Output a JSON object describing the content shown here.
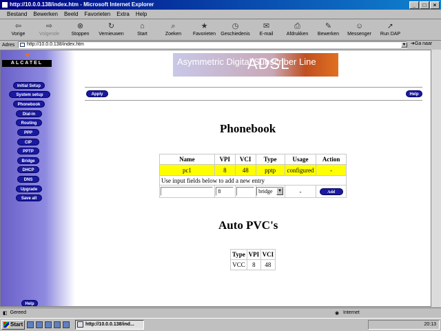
{
  "window": {
    "title": "http://10.0.0.138/index.htm - Microsoft Internet Explorer"
  },
  "menu": [
    "Bestand",
    "Bewerken",
    "Beeld",
    "Favorieten",
    "Extra",
    "Help"
  ],
  "toolbar": [
    {
      "label": "Vorige",
      "icon": "back-icon"
    },
    {
      "label": "Volgende",
      "icon": "forward-icon",
      "disabled": true
    },
    {
      "label": "Stoppen",
      "icon": "stop-icon"
    },
    {
      "label": "Vernieuwen",
      "icon": "refresh-icon"
    },
    {
      "label": "Start",
      "icon": "home-icon"
    },
    {
      "label": "Zoeken",
      "icon": "search-icon"
    },
    {
      "label": "Favorieten",
      "icon": "favorites-icon"
    },
    {
      "label": "Geschiedenis",
      "icon": "history-icon"
    },
    {
      "label": "E-mail",
      "icon": "mail-icon"
    },
    {
      "label": "Afdrukken",
      "icon": "print-icon"
    },
    {
      "label": "Bewerken",
      "icon": "edit-icon"
    },
    {
      "label": "Messenger",
      "icon": "messenger-icon"
    },
    {
      "label": "Run DAP",
      "icon": "dap-icon"
    }
  ],
  "address": {
    "label": "Adres",
    "url": "http://10.0.0.138/index.htm",
    "go": "Ga naar"
  },
  "sidebar": {
    "logo": "ALCATEL",
    "items": [
      "Initial Setup",
      "System setup",
      "Phonebook",
      "Dial-in",
      "Routing",
      "PPP",
      "CIP",
      "PPTP",
      "Bridge",
      "DHCP",
      "DNS",
      "Upgrade",
      "Save all"
    ],
    "help": "Help"
  },
  "banner": {
    "text": "Asymmetric Digital Subscriber Line",
    "logo": "ADSL"
  },
  "buttons": {
    "apply": "Apply",
    "help": "Help",
    "add": "Add"
  },
  "phonebook": {
    "title": "Phonebook",
    "headers": [
      "Name",
      "VPI",
      "VCI",
      "Type",
      "Usage",
      "Action"
    ],
    "rows": [
      [
        "pc1",
        "8",
        "48",
        "pptp",
        "configured",
        "-"
      ]
    ],
    "hint": "Use input fields below to add a new entry",
    "input": {
      "name": "",
      "vpi": "8",
      "vci": "",
      "type": "bridge",
      "usage": "-"
    }
  },
  "autopvc": {
    "title": "Auto PVC's",
    "headers": [
      "Type",
      "VPI",
      "VCI"
    ],
    "rows": [
      [
        "VCC",
        "8",
        "48"
      ]
    ]
  },
  "status": {
    "left": "Gereed",
    "zone": "Internet"
  },
  "taskbar": {
    "start": "Start",
    "item": "http://10.0.0.138/ind...",
    "clock": "20:13"
  },
  "colors": {
    "highlight_row": "#ffff00",
    "nav_button": "#1a1aa0",
    "title_bar": "#000080"
  }
}
